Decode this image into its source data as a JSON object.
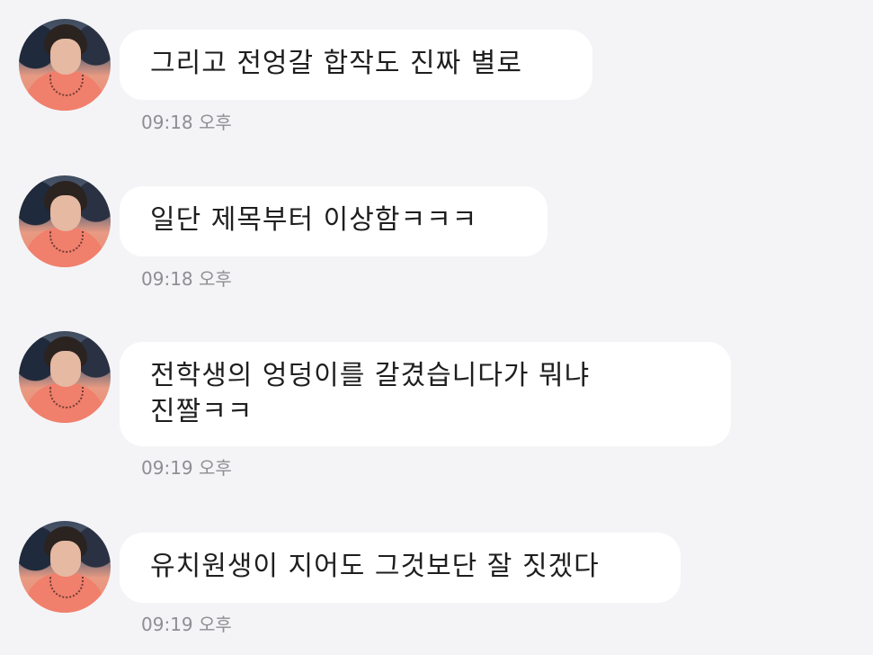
{
  "chat": {
    "messages": [
      {
        "lines": [
          "그리고 전엉갈 합작도 진짜 별로"
        ],
        "time": "09:18",
        "period": "오후"
      },
      {
        "lines": [
          "일단 제목부터 이상함ㅋㅋㅋ"
        ],
        "time": "09:18",
        "period": "오후"
      },
      {
        "lines": [
          "전학생의 엉덩이를 갈겼습니다가 뭐냐",
          "진짤ㅋㅋ"
        ],
        "time": "09:19",
        "period": "오후"
      },
      {
        "lines": [
          "유치원생이 지어도 그것보단 잘 짓겠다"
        ],
        "time": "09:19",
        "period": "오후"
      }
    ]
  }
}
